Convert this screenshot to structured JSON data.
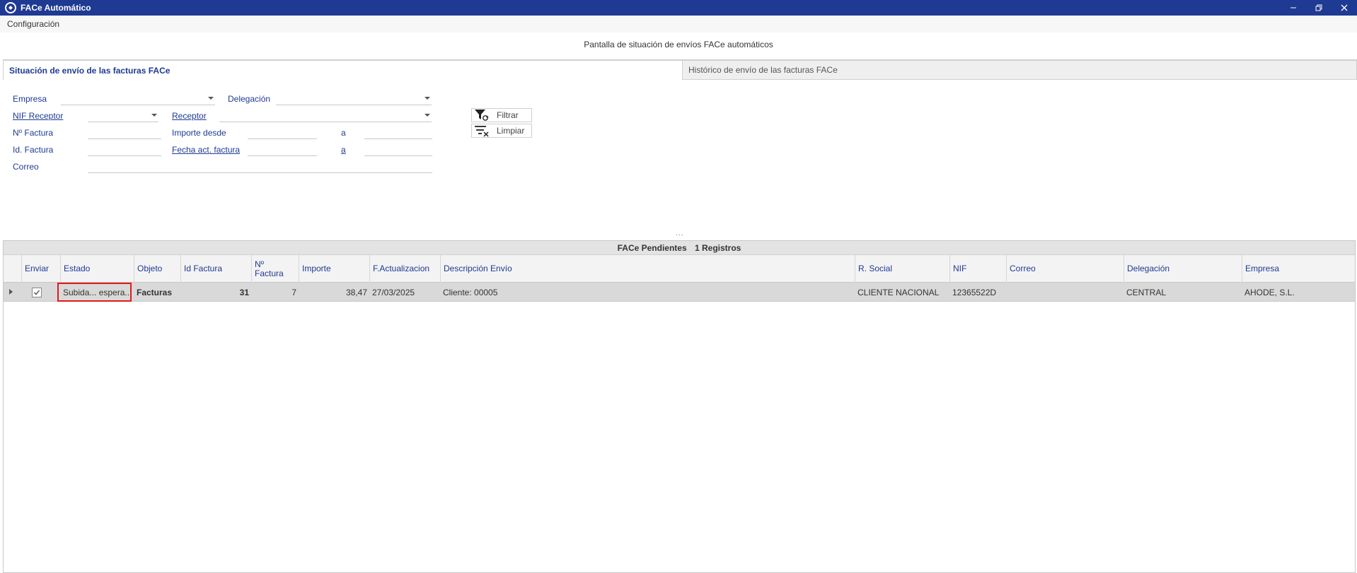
{
  "window": {
    "title": "FACe Automático"
  },
  "menu": {
    "configuracion": "Configuración"
  },
  "page": {
    "heading": "Pantalla de situación de envíos FACe automáticos"
  },
  "tabs": [
    {
      "label": "Situación de envío de las facturas FACe",
      "active": true
    },
    {
      "label": "Histórico de envío de las facturas FACe",
      "active": false
    }
  ],
  "filters": {
    "empresa": "Empresa",
    "delegacion": "Delegación",
    "nif_receptor": "NIF Receptor",
    "receptor": "Receptor",
    "n_factura": "Nº Factura",
    "importe_desde": "Importe desde",
    "a1": "a",
    "id_factura": "Id. Factura",
    "fecha_act_factura": "Fecha act. factura",
    "a2": "a",
    "correo": "Correo"
  },
  "buttons": {
    "filtrar": "Filtrar",
    "limpiar": "Limpiar"
  },
  "grid": {
    "title": "FACe Pendientes",
    "count": "1 Registros",
    "columns": [
      "Enviar",
      "Estado",
      "Objeto",
      "Id Factura",
      "Nº Factura",
      "Importe",
      "F.Actualizacion",
      "Descripción Envío",
      "R. Social",
      "NIF",
      "Correo",
      "Delegación",
      "Empresa"
    ],
    "rows": [
      {
        "enviar": true,
        "estado": "Subida... espera...",
        "objeto": "Facturas",
        "id_factura": "31",
        "n_factura": "7",
        "importe": "38,47",
        "f_actualizacion": "27/03/2025",
        "descripcion": "Cliente: 00005",
        "r_social": "CLIENTE NACIONAL",
        "nif": "12365522D",
        "correo": "",
        "delegacion": "CENTRAL",
        "empresa": "AHODE, S.L."
      }
    ]
  },
  "colors": {
    "titlebar": "#1f3a93",
    "label": "#1f3a93",
    "highlight": "#e01b1b"
  }
}
